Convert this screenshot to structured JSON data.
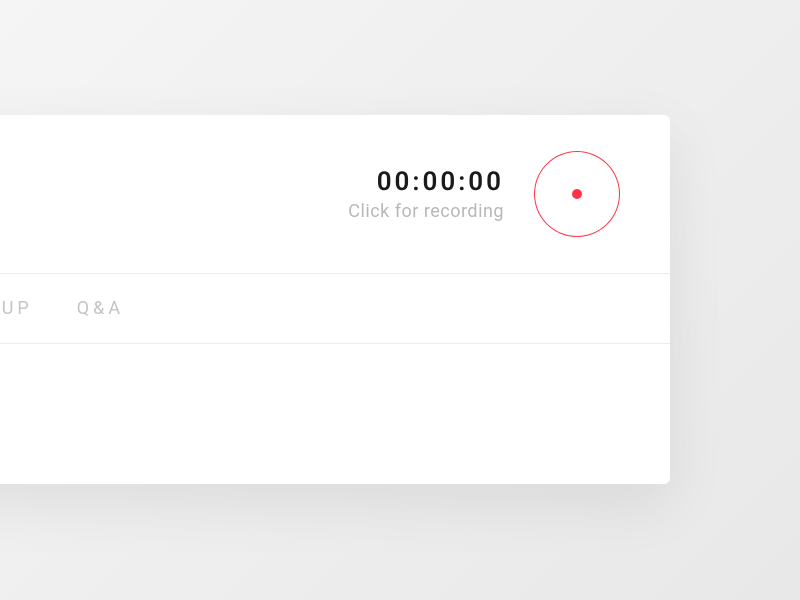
{
  "header": {
    "timer_value": "00:00:00",
    "timer_hint": "Click for recording"
  },
  "tabs": {
    "group": "GROUP",
    "qa": "Q&A"
  },
  "colors": {
    "accent": "#ff3243"
  }
}
